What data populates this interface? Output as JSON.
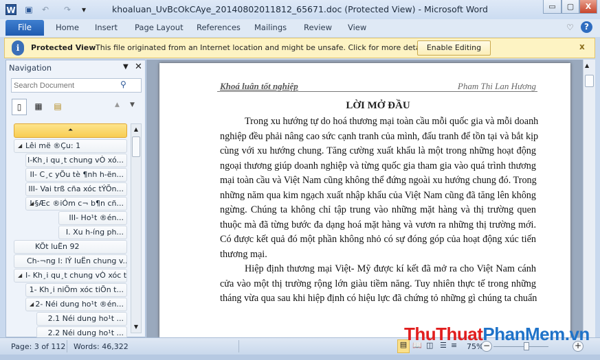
{
  "window": {
    "title": "khoaluan_UvBcOkCAye_20140802011812_65671.doc (Protected View) - Microsoft Word",
    "minimize": "▭",
    "maximize": "▢",
    "close": "X"
  },
  "quick_access": {
    "word_icon": "W",
    "save": "💾",
    "undo": "↶",
    "redo": "↷",
    "customize": "▾"
  },
  "ribbon": {
    "tabs": [
      "File",
      "Home",
      "Insert",
      "Page Layout",
      "References",
      "Mailings",
      "Review",
      "View"
    ],
    "heart": "♡",
    "help": "?"
  },
  "message_bar": {
    "title": "Protected View",
    "text": "This file originated from an Internet location and might be unsafe. Click for more details.",
    "button": "Enable Editing",
    "close": "x",
    "icon": "i"
  },
  "navigation": {
    "title": "Navigation",
    "search_placeholder": "Search Document",
    "items": [
      {
        "label": "Lêi më ®Çu: 1",
        "level": 0,
        "expanded": true
      },
      {
        "label": "I-Kh¸i qu¸t chung vÒ xó...",
        "level": 1
      },
      {
        "label": "II- C¸c yÕu tè ¶nh h-ën...",
        "level": 1
      },
      {
        "label": "III- Vai trß cña xóc tÝÕn...",
        "level": 1
      },
      {
        "label": "I-§Æc ®iÓm c¬ b¶n cñ...",
        "level": 1,
        "expanded": true
      },
      {
        "label": "III- Ho¹t ®én...",
        "level": 3
      },
      {
        "label": "I. Xu h-íng ph...",
        "level": 3
      },
      {
        "label": "KÕt luËn 92",
        "level": 0
      },
      {
        "label": "Ch-¬ng I: lÝ luËn chung v...",
        "level": 0
      },
      {
        "label": "I- Kh¸i qu¸t chung vÒ xóc ti...",
        "level": 0,
        "expanded": true
      },
      {
        "label": "1- Kh¸i niÖm xóc tiÕn t...",
        "level": 1
      },
      {
        "label": "2- Néi dung ho¹t ®én...",
        "level": 1,
        "expanded": true
      },
      {
        "label": "2.1 Néi dung ho¹t ...",
        "level": 2
      },
      {
        "label": "2.2 Néi dung ho¹t ...",
        "level": 2
      }
    ]
  },
  "document": {
    "header_left": "Khoá luân tốt nghiệp",
    "header_right": "Pham Thi Lan Hương",
    "heading": "LỜI MỞ ĐẦU",
    "lines": [
      {
        "t": "Trong xu hướng tự do hoá thương mại toàn cầu mỗi quốc gia và mỗi doanh",
        "ind": true
      },
      {
        "t": "nghiệp đều phải nâng cao sức cạnh tranh của mình, đấu tranh để tồn tại và bắt kịp"
      },
      {
        "t": "cùng với xu hướng chung. Tăng cường xuất khẩu là một trong những hoạt động"
      },
      {
        "t": "ngoại thương giúp doanh nghiệp và từng quốc gia tham gia vào quá trình thương"
      },
      {
        "t": "mại toàn cầu và Việt Nam cũng không thể đứng ngoài xu hướng chung đó. Trong"
      },
      {
        "t": "những năm qua kim ngạch xuất nhập khẩu của Việt Nam cũng đã tăng lên không"
      },
      {
        "t": "ngừng. Chúng ta không chỉ tập trung vào những mặt hàng và thị trường quen"
      },
      {
        "t": "thuộc mà đã từng bước đa dạng hoá mặt hàng và vươn ra những thị trường mới."
      },
      {
        "t": "Có được kết quả đó một phần không nhỏ có sự đóng góp của hoạt động xúc tiến"
      },
      {
        "t": "thương mại.",
        "last": true
      },
      {
        "t": "Hiệp định thương mại Việt- Mỹ được kí kết đã mở ra cho Việt Nam cánh",
        "ind": true
      },
      {
        "t": "cửa vào một thị trường rộng lớn giàu tiềm năng. Tuy nhiên thực tế trong những"
      },
      {
        "t": "tháng vừa qua sau khi hiệp định có hiệu lực đã chứng tỏ những gì chúng ta chuẩn"
      }
    ]
  },
  "status": {
    "page": "Page: 3 of 112",
    "words": "Words: 46,322",
    "zoom": "75%"
  },
  "watermark": {
    "part1": "ThuThuat",
    "part2": "PhanMem",
    "part3": ".vn"
  }
}
